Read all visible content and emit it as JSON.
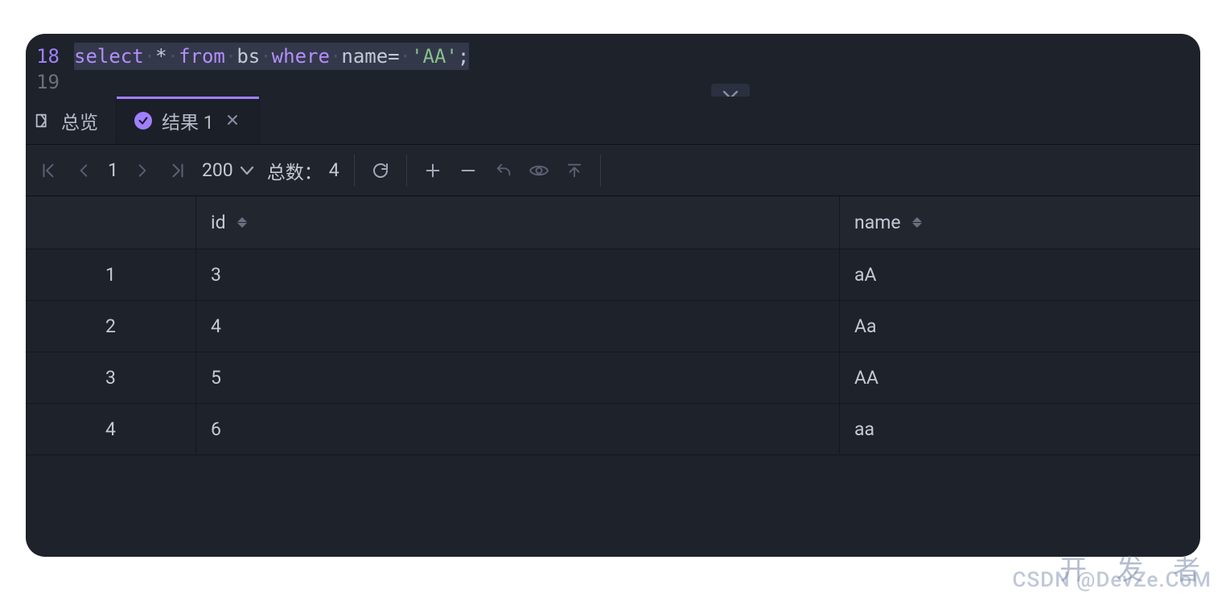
{
  "editor": {
    "lines": [
      {
        "num": "18",
        "active": true,
        "tokens": [
          {
            "cls": "kw",
            "t": "select"
          },
          {
            "cls": "dot",
            "t": "·"
          },
          {
            "cls": "op",
            "t": "*"
          },
          {
            "cls": "dot",
            "t": "·"
          },
          {
            "cls": "kw",
            "t": "from"
          },
          {
            "cls": "dot",
            "t": "·"
          },
          {
            "cls": "ident",
            "t": "bs"
          },
          {
            "cls": "dot",
            "t": "·"
          },
          {
            "cls": "kw",
            "t": "where"
          },
          {
            "cls": "dot",
            "t": "·"
          },
          {
            "cls": "ident",
            "t": "name"
          },
          {
            "cls": "op",
            "t": "="
          },
          {
            "cls": "dot",
            "t": "·"
          },
          {
            "cls": "str",
            "t": "'AA'"
          },
          {
            "cls": "punc",
            "t": ";"
          }
        ]
      },
      {
        "num": "19",
        "active": false,
        "tokens": []
      }
    ]
  },
  "tabs": {
    "overview_label": "总览",
    "result_label": "结果 1"
  },
  "toolbar": {
    "page": "1",
    "limit": "200",
    "total_label": "总数：",
    "total_value": "4"
  },
  "table": {
    "columns": [
      "id",
      "name"
    ],
    "rows": [
      {
        "n": "1",
        "id": "3",
        "name": "aA"
      },
      {
        "n": "2",
        "id": "4",
        "name": "Aa"
      },
      {
        "n": "3",
        "id": "5",
        "name": "AA"
      },
      {
        "n": "4",
        "id": "6",
        "name": "aa"
      }
    ]
  },
  "watermark": {
    "line1": "开 发 者",
    "line2": "CSDN @DevZe.CoM"
  }
}
